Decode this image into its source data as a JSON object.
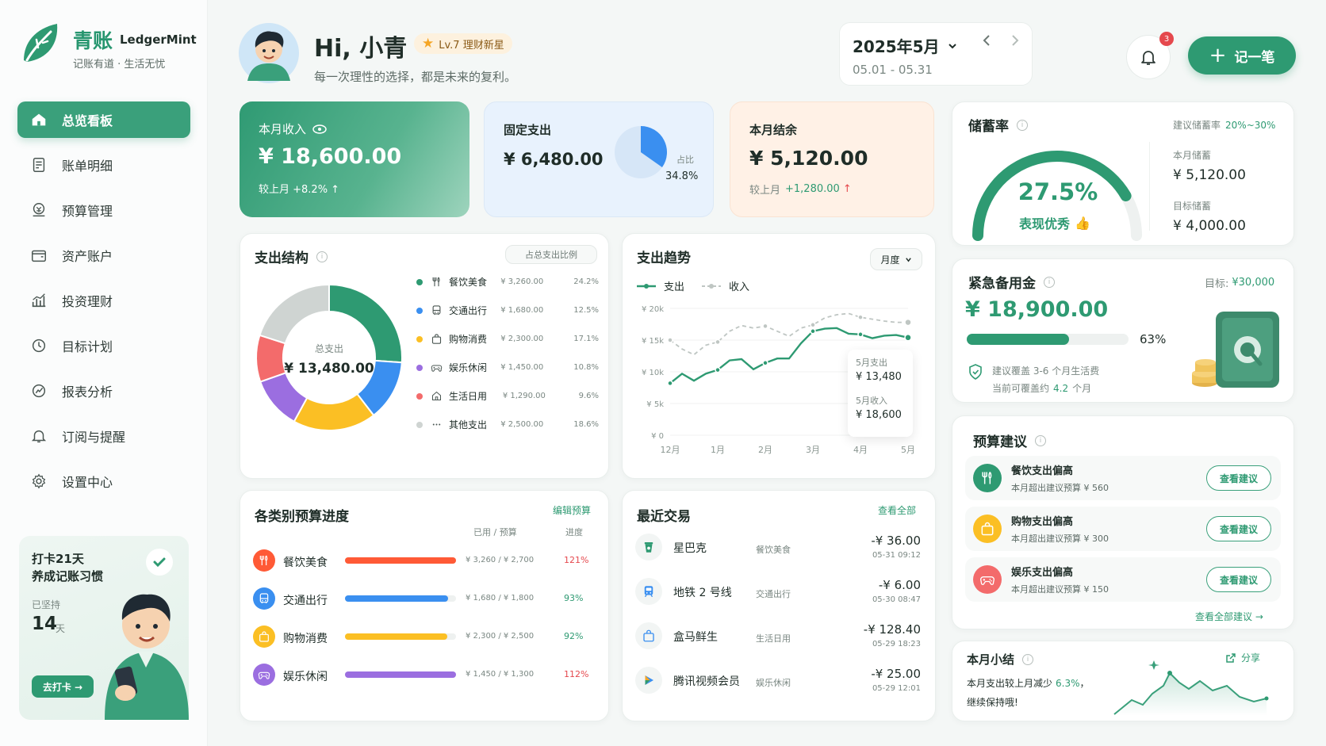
{
  "brand": {
    "name_cn": "青账",
    "name_en": "LedgerMint",
    "tagline": "记账有道 · 生活无忧"
  },
  "colors": {
    "primary": "#3aa07b",
    "up": "#e5484d",
    "food": "#ff7a45",
    "transport": "#3a8ff0",
    "shopping": "#fbbf24",
    "fun": "#9b6ee0",
    "daily": "#f36b6b",
    "other": "#cfd4d2"
  },
  "nav": [
    {
      "label": "总览看板",
      "icon": "home-icon"
    },
    {
      "label": "账单明细",
      "icon": "bill-icon"
    },
    {
      "label": "预算管理",
      "icon": "budget-icon"
    },
    {
      "label": "资产账户",
      "icon": "wallet-icon"
    },
    {
      "label": "投资理财",
      "icon": "chart-icon"
    },
    {
      "label": "目标计划",
      "icon": "target-icon"
    },
    {
      "label": "报表分析",
      "icon": "report-icon"
    },
    {
      "label": "订阅与提醒",
      "icon": "bell-icon"
    },
    {
      "label": "设置中心",
      "icon": "gear-icon"
    }
  ],
  "checkin": {
    "title": "打卡21天",
    "subtitle": "养成记账习惯",
    "streak_label": "已坚持",
    "streak_days": "14",
    "streak_unit": "天",
    "button": "去打卡 →"
  },
  "header": {
    "greeting": "Hi, 小青",
    "level": "Lv.7 理财新星",
    "motto": "每一次理性的选择，都是未来的复利。",
    "month": "2025年5月",
    "range": "05.01 - 05.31",
    "notif_count": "3",
    "add_button": "记一笔"
  },
  "income": {
    "label": "本月收入",
    "amount": "¥ 18,600.00",
    "compare": "较上月 +8.2% ↑"
  },
  "fixed": {
    "label": "固定支出",
    "amount": "¥ 6,480.00",
    "ratio_label": "占比",
    "ratio": "34.8%",
    "ratio_value": 0.348
  },
  "balance": {
    "label": "本月结余",
    "amount": "¥ 5,120.00",
    "compare_prefix": "较上月",
    "compare_value": "+1,280.00",
    "arrow": "↑"
  },
  "savings": {
    "title": "储蓄率",
    "suggest_label": "建议储蓄率",
    "suggest_value": "20%~30%",
    "rate": "27.5%",
    "rate_value": 0.275,
    "rating": "表现优秀",
    "month_label": "本月储蓄",
    "month_value": "¥ 5,120.00",
    "target_label": "目标储蓄",
    "target_value": "¥ 4,000.00"
  },
  "emergency": {
    "title": "紧急备用金",
    "target_label": "目标:",
    "target_value": "¥30,000",
    "amount": "¥ 18,900.00",
    "percent": "63%",
    "percent_value": 0.63,
    "tip1": "建议覆盖 3-6 个月生活费",
    "tip2_prefix": "当前可覆盖约",
    "tip2_value": "4.2",
    "tip2_suffix": "个月"
  },
  "structure": {
    "title": "支出结构",
    "badge": "占总支出比例",
    "center_label": "总支出",
    "center_value": "¥ 13,480.00",
    "items": [
      {
        "name": "餐饮美食",
        "amount": "¥ 3,260.00",
        "pct": "24.2%",
        "color": "#2e9a72",
        "icon": "utensils-icon"
      },
      {
        "name": "交通出行",
        "amount": "¥ 1,680.00",
        "pct": "12.5%",
        "color": "#3a8ff0",
        "icon": "bus-icon"
      },
      {
        "name": "购物消费",
        "amount": "¥ 2,300.00",
        "pct": "17.1%",
        "color": "#fbbf24",
        "icon": "bag-icon"
      },
      {
        "name": "娱乐休闲",
        "amount": "¥ 1,450.00",
        "pct": "10.8%",
        "color": "#9b6ee0",
        "icon": "gamepad-icon"
      },
      {
        "name": "生活日用",
        "amount": "¥ 1,290.00",
        "pct": "9.6%",
        "color": "#f36b6b",
        "icon": "house-icon"
      },
      {
        "name": "其他支出",
        "amount": "¥ 2,500.00",
        "pct": "18.6%",
        "color": "#cfd4d2",
        "icon": "more-icon"
      }
    ]
  },
  "trend": {
    "title": "支出趋势",
    "period": "月度",
    "legend_expense": "支出",
    "legend_income": "收入",
    "tooltip_exp_label": "5月支出",
    "tooltip_exp_value": "¥ 13,480",
    "tooltip_inc_label": "5月收入",
    "tooltip_inc_value": "¥ 18,600"
  },
  "chart_data": {
    "type": "line",
    "x": [
      "12月",
      "1月",
      "2月",
      "3月",
      "4月",
      "5月"
    ],
    "yticks": [
      "¥ 0",
      "¥ 5k",
      "¥ 10k",
      "¥ 15k",
      "¥ 20k"
    ],
    "ylim": [
      0,
      20000
    ],
    "xpoints": [
      0,
      0.25,
      0.5,
      0.75,
      1,
      1.25,
      1.5,
      1.75,
      2,
      2.25,
      2.5,
      2.75,
      3,
      3.25,
      3.5,
      3.75,
      4,
      4.25,
      4.5,
      4.75,
      5
    ],
    "series": [
      {
        "name": "支出",
        "color": "#2e9a72",
        "values": [
          8200,
          9700,
          8600,
          9700,
          10300,
          11800,
          12000,
          10400,
          11400,
          12100,
          12100,
          14500,
          16400,
          16800,
          16900,
          16000,
          15900,
          15300,
          15700,
          15800,
          15400
        ]
      },
      {
        "name": "收入",
        "color": "#bfc6c3",
        "values": [
          15000,
          13600,
          12700,
          14200,
          14700,
          16400,
          17300,
          16900,
          17200,
          16400,
          15600,
          16900,
          17400,
          18500,
          19000,
          19200,
          18600,
          18300,
          18000,
          17800,
          17800
        ]
      }
    ]
  },
  "budget": {
    "title": "各类别预算进度",
    "edit": "编辑预算",
    "col_used": "已用 / 预算",
    "col_progress": "进度",
    "items": [
      {
        "name": "餐饮美食",
        "value": "¥ 3,260 / ¥ 2,700",
        "pct": "121%",
        "ratio": 1.0,
        "color": "#ff5a36",
        "over": true,
        "icon": "utensils-icon"
      },
      {
        "name": "交通出行",
        "value": "¥ 1,680 / ¥ 1,800",
        "pct": "93%",
        "ratio": 0.93,
        "color": "#3a8ff0",
        "over": false,
        "icon": "bus-icon"
      },
      {
        "name": "购物消费",
        "value": "¥ 2,300 / ¥ 2,500",
        "pct": "92%",
        "ratio": 0.92,
        "color": "#fbbf24",
        "over": false,
        "icon": "bag-icon"
      },
      {
        "name": "娱乐休闲",
        "value": "¥ 1,450 / ¥ 1,300",
        "pct": "112%",
        "ratio": 1.0,
        "color": "#9b6ee0",
        "over": true,
        "icon": "gamepad-icon"
      }
    ]
  },
  "recent": {
    "title": "最近交易",
    "view_all": "查看全部",
    "items": [
      {
        "name": "星巴克",
        "cat": "餐饮美食",
        "amount": "-¥ 36.00",
        "time": "05-31 09:12",
        "icon": "cup-icon"
      },
      {
        "name": "地铁 2 号线",
        "cat": "交通出行",
        "amount": "-¥ 6.00",
        "time": "05-30 08:47",
        "icon": "metro-icon"
      },
      {
        "name": "盒马鲜生",
        "cat": "生活日用",
        "amount": "-¥ 128.40",
        "time": "05-29 18:23",
        "icon": "bag-icon"
      },
      {
        "name": "腾讯视频会员",
        "cat": "娱乐休闲",
        "amount": "-¥ 25.00",
        "time": "05-29 12:01",
        "icon": "play-icon"
      }
    ]
  },
  "advice": {
    "title": "预算建议",
    "view_all": "查看全部建议 →",
    "items": [
      {
        "title": "餐饮支出偏高",
        "desc": "本月超出建议预算 ¥ 560",
        "button": "查看建议",
        "color": "#2e9a72",
        "icon": "utensils-icon"
      },
      {
        "title": "购物支出偏高",
        "desc": "本月超出建议预算 ¥ 300",
        "button": "查看建议",
        "color": "#fbbf24",
        "icon": "bag-icon"
      },
      {
        "title": "娱乐支出偏高",
        "desc": "本月超出建议预算 ¥ 150",
        "button": "查看建议",
        "color": "#f36b6b",
        "icon": "gamepad-icon"
      }
    ]
  },
  "summary": {
    "title": "本月小结",
    "share": "分享",
    "text_prefix": "本月支出较上月减少",
    "text_value": "6.3%",
    "text_suffix": "，",
    "text_line2": "继续保持哦!"
  }
}
